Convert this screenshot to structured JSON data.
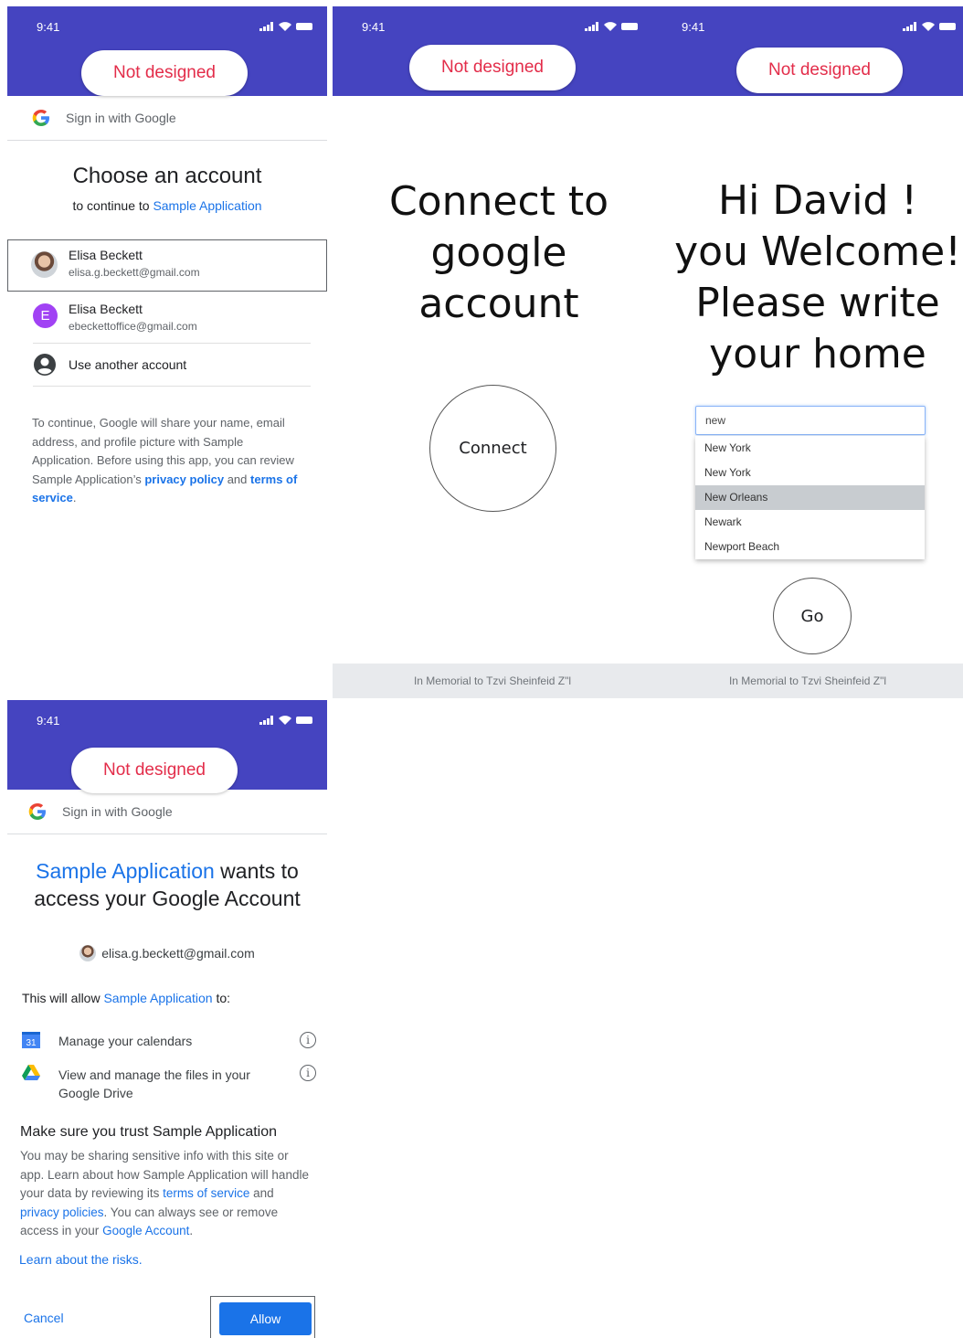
{
  "status_time": "9:41",
  "not_designed": "Not designed",
  "google_bar": "Sign in with Google",
  "chooser": {
    "title": "Choose an account",
    "subtitle_prefix": "to continue to",
    "app_name": "Sample Application",
    "accounts": [
      {
        "name": "Elisa Beckett",
        "email": "elisa.g.beckett@gmail.com",
        "avatar": "photo"
      },
      {
        "name": "Elisa Beckett",
        "email": "ebeckettoffice@gmail.com",
        "avatar": "E"
      }
    ],
    "use_another": "Use another account",
    "disclaimer_pre": "To continue, Google will share your name, email address, and profile picture with Sample Application. Before using this app, you can review Sample Application’s",
    "privacy_policy": "privacy policy",
    "and": "and",
    "terms": "terms of service",
    "period": "."
  },
  "connect": {
    "title_lines": [
      "Connect to",
      "google",
      "account"
    ],
    "button": "Connect",
    "footer": "In Memorial to Tzvi Sheinfeid Z\"l"
  },
  "home": {
    "title_lines": [
      "Hi David !",
      "you Welcome!",
      "Please write",
      "your home"
    ],
    "input_value": "new",
    "options": [
      "New York",
      "New York",
      "New Orleans",
      "Newark",
      "Newport Beach"
    ],
    "selected_index": 2,
    "go": "Go",
    "footer": "In Memorial to Tzvi Sheinfeid Z\"l"
  },
  "consent": {
    "app_name": "Sample Application",
    "title_rest": "wants to access your Google Account",
    "email": "elisa.g.beckett@gmail.com",
    "allow_intro_pre": "This will allow",
    "allow_intro_post": "to:",
    "permissions": [
      {
        "icon": "calendar-icon",
        "label": "Manage your calendars",
        "badge": "31"
      },
      {
        "icon": "drive-icon",
        "label": "View and manage the files in your Google Drive"
      }
    ],
    "trust_title": "Make sure you trust Sample Application",
    "trust_body_pre": "You may be sharing sensitive info with this site or app. Learn about how Sample Application will handle your data by reviewing its",
    "terms_link": "terms of service",
    "and": "and",
    "privacy_link": "privacy policies",
    "trust_body_mid": ". You can always see or remove access in your",
    "account_link": "Google Account",
    "period": ".",
    "learn_risks": "Learn about the risks.",
    "cancel": "Cancel",
    "allow": "Allow"
  },
  "colors": {
    "header": "#4544c0",
    "not_designed_text": "#e32d4a",
    "link": "#1a73e8",
    "allow_button": "#1a73e8"
  }
}
